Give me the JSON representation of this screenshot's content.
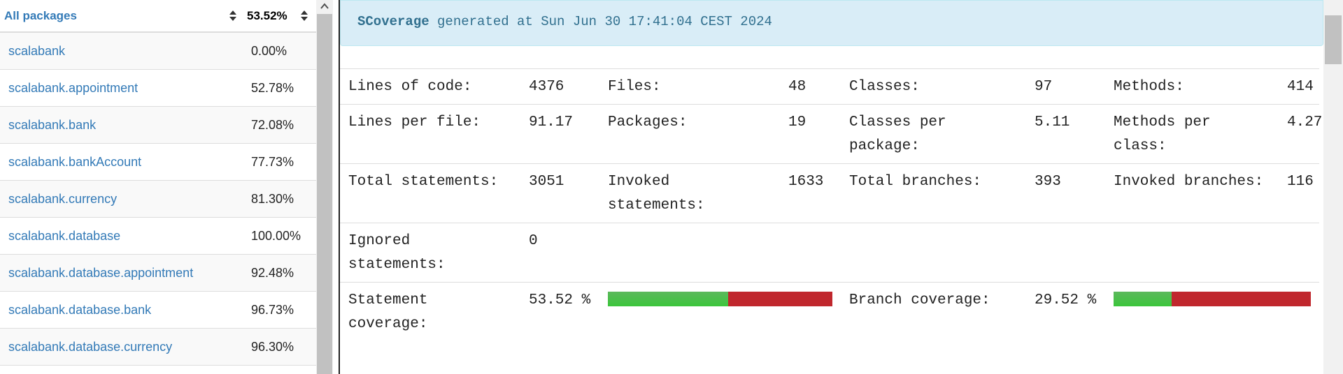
{
  "packages": {
    "header": {
      "name": "All packages",
      "coverage": "53.52%"
    },
    "rows": [
      {
        "name": "scalabank",
        "coverage": "0.00%"
      },
      {
        "name": "scalabank.appointment",
        "coverage": "52.78%"
      },
      {
        "name": "scalabank.bank",
        "coverage": "72.08%"
      },
      {
        "name": "scalabank.bankAccount",
        "coverage": "77.73%"
      },
      {
        "name": "scalabank.currency",
        "coverage": "81.30%"
      },
      {
        "name": "scalabank.database",
        "coverage": "100.00%"
      },
      {
        "name": "scalabank.database.appointment",
        "coverage": "92.48%"
      },
      {
        "name": "scalabank.database.bank",
        "coverage": "96.73%"
      },
      {
        "name": "scalabank.database.currency",
        "coverage": "96.30%"
      }
    ]
  },
  "banner": {
    "brand": "SCoverage",
    "text": "generated at Sun Jun 30 17:41:04 CEST 2024"
  },
  "stats": {
    "lines_of_code": {
      "label": "Lines of code:",
      "value": "4376"
    },
    "files": {
      "label": "Files:",
      "value": "48"
    },
    "classes": {
      "label": "Classes:",
      "value": "97"
    },
    "methods": {
      "label": "Methods:",
      "value": "414"
    },
    "lines_per_file": {
      "label": "Lines per file:",
      "value": "91.17"
    },
    "packages": {
      "label": "Packages:",
      "value": "19"
    },
    "classes_per_package": {
      "label": "Classes per package:",
      "value": "5.11"
    },
    "methods_per_class": {
      "label": "Methods per class:",
      "value": "4.27"
    },
    "total_statements": {
      "label": "Total statements:",
      "value": "3051"
    },
    "invoked_statements": {
      "label": "Invoked statements:",
      "value": "1633"
    },
    "total_branches": {
      "label": "Total branches:",
      "value": "393"
    },
    "invoked_branches": {
      "label": "Invoked branches:",
      "value": "116"
    },
    "ignored_statements": {
      "label": "Ignored statements:",
      "value": "0"
    },
    "statement_coverage": {
      "label": "Statement coverage:",
      "value": "53.52 %",
      "fraction": 0.5352
    },
    "branch_coverage": {
      "label": "Branch coverage:",
      "value": "29.52 %",
      "fraction": 0.2952
    }
  },
  "colors": {
    "covered": "#3bc63b",
    "uncovered": "#c0272d",
    "link": "#337ab7",
    "banner_bg": "#d9edf7"
  },
  "icons": {
    "sort": "sort-icon",
    "scroll_up": "chevron-up-icon"
  }
}
